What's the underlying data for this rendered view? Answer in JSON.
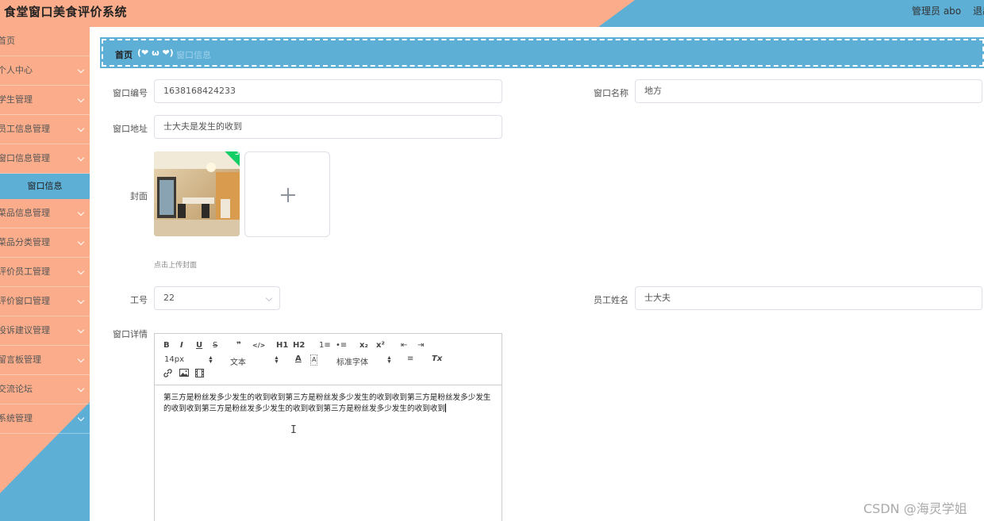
{
  "header": {
    "title": "食堂窗口美食评价系统",
    "user": "管理员 abo",
    "logout": "退出",
    "colors": {
      "salmon": "#fbad8b",
      "blue": "#5dafd6"
    }
  },
  "sidebar": {
    "items": [
      {
        "label": "首页",
        "chevron": false
      },
      {
        "label": "个人中心",
        "chevron": true
      },
      {
        "label": "学生管理",
        "chevron": true
      },
      {
        "label": "员工信息管理",
        "chevron": true
      },
      {
        "label": "窗口信息管理",
        "chevron": true
      },
      {
        "label": "菜品信息管理",
        "chevron": true
      },
      {
        "label": "菜品分类管理",
        "chevron": true
      },
      {
        "label": "评价员工管理",
        "chevron": true
      },
      {
        "label": "评价窗口管理",
        "chevron": true
      },
      {
        "label": "投诉建议管理",
        "chevron": true
      },
      {
        "label": "留言板管理",
        "chevron": true
      },
      {
        "label": "交流论坛",
        "chevron": true
      },
      {
        "label": "系统管理",
        "chevron": true
      }
    ],
    "active_sub": "窗口信息"
  },
  "breadcrumb": {
    "home": "首页",
    "emoji": "(❤ ω ❤)",
    "current": "窗口信息"
  },
  "form": {
    "window_no": {
      "label": "窗口编号",
      "value": "1638168424233"
    },
    "window_name": {
      "label": "窗口名称",
      "value": "地方"
    },
    "window_addr": {
      "label": "窗口地址",
      "value": "士大夫是发生的收到"
    },
    "cover": {
      "label": "封面",
      "tip": "点击上传封面"
    },
    "job_no": {
      "label": "工号",
      "value": "22"
    },
    "staff_name": {
      "label": "员工姓名",
      "value": "士大夫"
    },
    "detail": {
      "label": "窗口详情",
      "toolbar": {
        "bold": "B",
        "italic": "I",
        "underline": "U",
        "strike": "S",
        "quote": "❞",
        "code": "</>",
        "h1": "H1",
        "h2": "H2",
        "ol": "1≡",
        "ul": "•≡",
        "sub": "x₂",
        "sup": "x²",
        "outdent": "⇤",
        "indent": "⇥",
        "size": "14px",
        "style": "文本",
        "font": "标准字体",
        "color": "A",
        "bg": "A",
        "align": "≡",
        "clean": "Tx"
      },
      "content": "第三方是粉丝发多少发生的收到收到第三方是粉丝发多少发生的收到收到第三方是粉丝发多少发生的收到收到第三方是粉丝发多少发生的收到收到第三方是粉丝发多少发生的收到收到"
    }
  },
  "watermark": "CSDN @海灵学姐"
}
